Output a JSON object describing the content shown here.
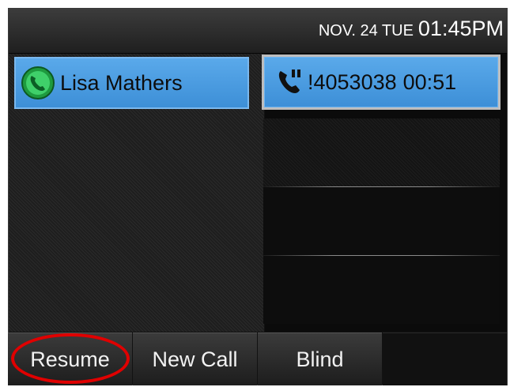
{
  "status_bar": {
    "date": "NOV. 24 TUE",
    "time": "01:45PM"
  },
  "line_keys": {
    "contact": {
      "name": "Lisa Mathers",
      "icon": "phone-green-icon"
    },
    "active_call": {
      "number": "!4053038",
      "duration": "00:51",
      "icon": "handset-call-icon"
    }
  },
  "softkeys": [
    {
      "label": "Resume"
    },
    {
      "label": "New Call"
    },
    {
      "label": "Blind"
    },
    {
      "label": ""
    }
  ],
  "colors": {
    "line_key_blue": "#4a9be0",
    "highlight_red": "#e00000",
    "presence_green": "#22b04b"
  }
}
